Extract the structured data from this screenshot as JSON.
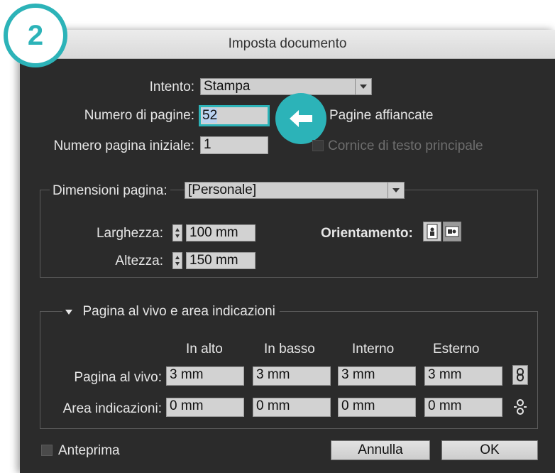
{
  "step_badge": "2",
  "window": {
    "title": "Imposta documento"
  },
  "intent": {
    "label": "Intento:",
    "value": "Stampa"
  },
  "pages": {
    "count_label": "Numero di pagine:",
    "count_value": "52",
    "facing_label": "Pagine affiancate",
    "start_label": "Numero pagina iniziale:",
    "start_value": "1",
    "master_frame_label": "Cornice di testo principale"
  },
  "page_size": {
    "label": "Dimensioni pagina:",
    "value": "[Personale]",
    "width_label": "Larghezza:",
    "width_value": "100 mm",
    "height_label": "Altezza:",
    "height_value": "150 mm",
    "orientation_label": "Orientamento:"
  },
  "bleed": {
    "section_title": "Pagina al vivo e area indicazioni",
    "columns": [
      "In alto",
      "In basso",
      "Interno",
      "Esterno"
    ],
    "rows": [
      {
        "label": "Pagina al vivo:",
        "values": [
          "3 mm",
          "3 mm",
          "3 mm",
          "3 mm"
        ]
      },
      {
        "label": "Area indicazioni:",
        "values": [
          "0 mm",
          "0 mm",
          "0 mm",
          "0 mm"
        ]
      }
    ]
  },
  "footer": {
    "preview_label": "Anteprima",
    "cancel_label": "Annulla",
    "ok_label": "OK"
  },
  "icons": {
    "arrow": "arrow-left-icon",
    "link": "chain-link-icon",
    "unlink": "broken-link-icon"
  },
  "colors": {
    "accent": "#2cb3b8",
    "panel": "#2b2b2b"
  }
}
